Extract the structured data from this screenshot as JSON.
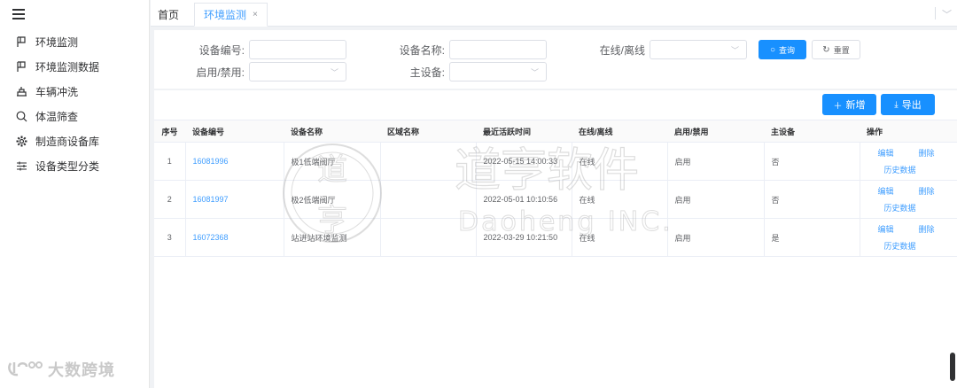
{
  "sidebar": {
    "items": [
      {
        "label": "环境监测",
        "icon": "flag-icon"
      },
      {
        "label": "环境监测数据",
        "icon": "flag-icon"
      },
      {
        "label": "车辆冲洗",
        "icon": "washer-icon"
      },
      {
        "label": "体温筛查",
        "icon": "search-icon"
      },
      {
        "label": "制造商设备库",
        "icon": "gear-icon"
      },
      {
        "label": "设备类型分类",
        "icon": "sliders-icon"
      }
    ],
    "brand": "大数跨境"
  },
  "tabs": {
    "home": "首页",
    "active": "环境监测",
    "close": "×"
  },
  "search": {
    "device_no_label": "设备编号:",
    "device_name_label": "设备名称:",
    "online_label": "在线/离线",
    "enable_label": "启用/禁用:",
    "master_label": "主设备:",
    "query_button": "查询",
    "reset_button": "重置"
  },
  "toolbar": {
    "add_button": "新增",
    "export_button": "导出"
  },
  "table": {
    "headers": [
      "序号",
      "设备编号",
      "设备名称",
      "区域名称",
      "最近活跃时间",
      "在线/离线",
      "启用/禁用",
      "主设备",
      "操作"
    ],
    "rows": [
      {
        "index": "1",
        "device_no": "16081996",
        "device_name": "极1低端阀厅",
        "area": "",
        "last_active": "2022-05-15 14:00:33",
        "online": "在线",
        "enabled": "启用",
        "master": "否"
      },
      {
        "index": "2",
        "device_no": "16081997",
        "device_name": "极2低端阀厅",
        "area": "",
        "last_active": "2022-05-01 10:10:56",
        "online": "在线",
        "enabled": "启用",
        "master": "否"
      },
      {
        "index": "3",
        "device_no": "16072368",
        "device_name": "站进站环境监测",
        "area": "",
        "last_active": "2022-03-29 10:21:50",
        "online": "在线",
        "enabled": "启用",
        "master": "是"
      }
    ],
    "ops": {
      "edit": "编辑",
      "delete": "删除",
      "history": "历史数据"
    }
  },
  "watermark": {
    "cn": "道亨软件",
    "en": "Daoheng INC."
  },
  "colors": {
    "primary": "#1890ff",
    "link": "#409eff"
  }
}
